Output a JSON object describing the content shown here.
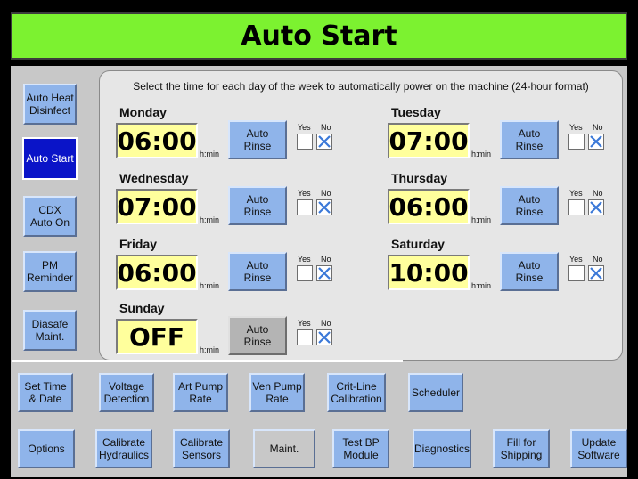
{
  "title": "Auto Start",
  "instruction": "Select the time for each day of the week to automatically power on the machine (24-hour format)",
  "units": "h:min",
  "yes_label": "Yes",
  "no_label": "No",
  "rinse_label": "Auto\nRinse",
  "days": [
    {
      "name": "Monday",
      "time": "06:00",
      "rinse_yes": false,
      "rinse_no": true,
      "enabled": true
    },
    {
      "name": "Tuesday",
      "time": "07:00",
      "rinse_yes": false,
      "rinse_no": true,
      "enabled": true
    },
    {
      "name": "Wednesday",
      "time": "07:00",
      "rinse_yes": false,
      "rinse_no": true,
      "enabled": true
    },
    {
      "name": "Thursday",
      "time": "06:00",
      "rinse_yes": false,
      "rinse_no": true,
      "enabled": true
    },
    {
      "name": "Friday",
      "time": "06:00",
      "rinse_yes": false,
      "rinse_no": true,
      "enabled": true
    },
    {
      "name": "Saturday",
      "time": "10:00",
      "rinse_yes": false,
      "rinse_no": true,
      "enabled": true
    },
    {
      "name": "Sunday",
      "time": "OFF",
      "rinse_yes": false,
      "rinse_no": true,
      "enabled": false
    }
  ],
  "side_tabs": [
    {
      "label": "Auto Heat\nDisinfect",
      "active": false
    },
    {
      "label": "Auto Start",
      "active": true
    },
    {
      "label": "CDX\nAuto On",
      "active": false
    },
    {
      "label": "PM\nReminder",
      "active": false
    },
    {
      "label": "Diasafe\nMaint.",
      "active": false
    }
  ],
  "row1_tabs": [
    {
      "label": "Set Time\n& Date"
    },
    {
      "label": "Voltage\nDetection"
    },
    {
      "label": "Art Pump\nRate"
    },
    {
      "label": "Ven Pump\nRate"
    },
    {
      "label": "Crit-Line\nCalibration"
    },
    {
      "label": "Scheduler"
    }
  ],
  "row2_tabs": [
    {
      "label": "Options"
    },
    {
      "label": "Calibrate\nHydraulics"
    },
    {
      "label": "Calibrate\nSensors"
    },
    {
      "label": "Maint."
    },
    {
      "label": "Test BP\nModule"
    },
    {
      "label": "Diagnostics"
    },
    {
      "label": "Fill for\nShipping"
    },
    {
      "label": "Update\nSoftware"
    }
  ],
  "colors": {
    "title_bg": "#7cf230",
    "button_blue": "#8fb4ea",
    "active_tab": "#0a14c8",
    "time_bg": "#ffff9c",
    "checkmark_x": "#3a78d8"
  }
}
